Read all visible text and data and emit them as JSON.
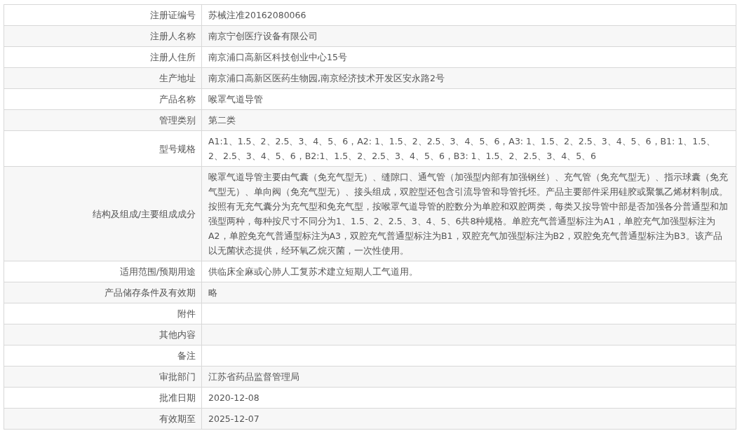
{
  "table": {
    "rows": [
      {
        "label": "注册证编号",
        "value": "苏械注准20162080066"
      },
      {
        "label": "注册人名称",
        "value": "南京宁创医疗设备有限公司"
      },
      {
        "label": "注册人住所",
        "value": "南京浦口高新区科技创业中心15号"
      },
      {
        "label": "生产地址",
        "value": "南京浦口高新区医药生物园,南京经济技术开发区安永路2号"
      },
      {
        "label": "产品名称",
        "value": "喉罩气道导管"
      },
      {
        "label": "管理类别",
        "value": "第二类"
      },
      {
        "label": "型号规格",
        "value": "A1:1、1.5、2、2.5、3、4、5、6，A2: 1、1.5、2、2.5、3、4、5、6，A3: 1、1.5、2、2.5、3、4、5、6，B1: 1、1.5、2、2.5、3、4、5、6，B2:1、1.5、2、2.5、3、4、5、6，B3: 1、1.5、2、2.5、3、4、5、6"
      },
      {
        "label": "结构及组成/主要组成成分",
        "value": "喉罩气道导管主要由气囊（免充气型无）、缝隙口、通气管（加强型内部有加强钢丝）、充气管（免充气型无）、指示球囊（免充气型无）、单向阀（免充气型无）、接头组成，双腔型还包含引流导管和导管托坯。产品主要部件采用硅胶或聚氯乙烯材料制成。按照有无充气囊分为充气型和免充气型，按喉罩气道导管的腔数分为单腔和双腔两类，每类又按导管中部是否加强各分普通型和加强型两种，每种按尺寸不同分为1、1.5、2、2.5、3、4、5、6共8种规格。单腔充气普通型标注为A1，单腔充气加强型标注为A2，单腔免充气普通型标注为A3，双腔充气普通型标注为B1，双腔充气加强型标注为B2，双腔免充气普通型标注为B3。该产品以无菌状态提供，经环氧乙烷灭菌，一次性使用。"
      },
      {
        "label": "适用范围/预期用途",
        "value": "供临床全麻或心肺人工复苏术建立短期人工气道用。"
      },
      {
        "label": "产品储存条件及有效期",
        "value": "略"
      },
      {
        "label": "附件"
      },
      {
        "label": "其他内容"
      },
      {
        "label": "备注"
      },
      {
        "label": "审批部门",
        "value": "江苏省药品监督管理局"
      },
      {
        "label": "批准日期",
        "value": "2020-12-08"
      },
      {
        "label": "有效期至",
        "value": "2025-12-07"
      }
    ]
  }
}
